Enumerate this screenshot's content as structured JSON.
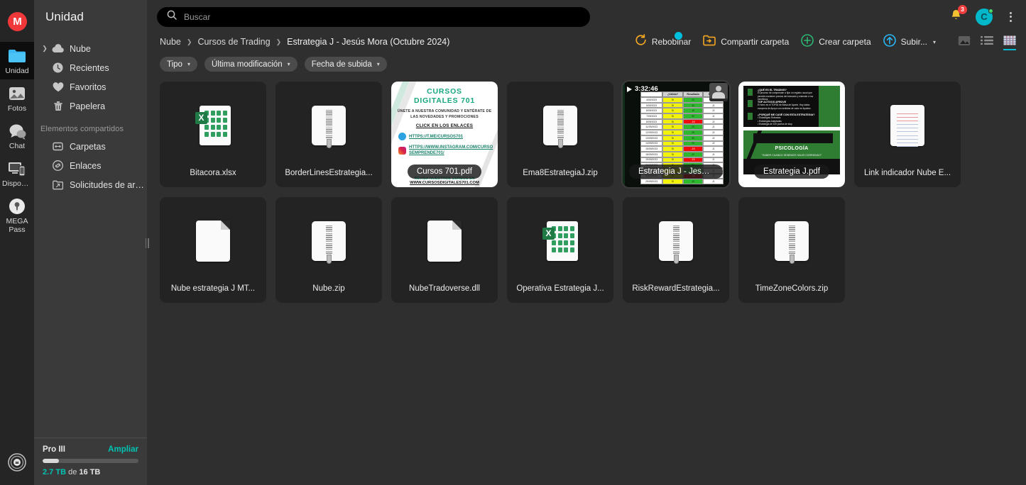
{
  "app": {
    "logo_letter": "M",
    "sidebar_title": "Unidad"
  },
  "rail": {
    "items": [
      {
        "name": "unidad",
        "label": "Unidad",
        "icon": "folder-icon",
        "active": true
      },
      {
        "name": "fotos",
        "label": "Fotos",
        "icon": "photo-icon",
        "active": false
      },
      {
        "name": "chat",
        "label": "Chat",
        "icon": "chat-bubble-icon",
        "active": false
      },
      {
        "name": "dispositivos",
        "label": "Disposi...",
        "icon": "devices-icon",
        "active": false
      },
      {
        "name": "mega-pass",
        "label": "MEGA Pass",
        "icon": "lock-key-icon",
        "active": false
      }
    ]
  },
  "sidebar": {
    "nav": [
      {
        "name": "nube",
        "label": "Nube",
        "icon": "cloud-icon",
        "expandable": true
      },
      {
        "name": "recientes",
        "label": "Recientes",
        "icon": "clock-icon"
      },
      {
        "name": "favoritos",
        "label": "Favoritos",
        "icon": "heart-icon"
      },
      {
        "name": "papelera",
        "label": "Papelera",
        "icon": "trash-icon"
      }
    ],
    "shared_section_label": "Elementos compartidos",
    "shared": [
      {
        "name": "carpetas",
        "label": "Carpetas",
        "icon": "shared-folder-icon"
      },
      {
        "name": "enlaces",
        "label": "Enlaces",
        "icon": "link-icon"
      },
      {
        "name": "solicitudes",
        "label": "Solicitudes de arc...",
        "icon": "file-request-icon"
      }
    ],
    "storage": {
      "plan": "Pro III",
      "upgrade_label": "Ampliar",
      "used": "2.7 TB",
      "of_word": "de",
      "total": "16 TB",
      "percent": 17,
      "accent_color": "#00c3b2"
    }
  },
  "search": {
    "placeholder": "Buscar",
    "value": "",
    "icon": "search-icon"
  },
  "header": {
    "notifications": {
      "icon": "bell-icon",
      "count": "3"
    },
    "avatar": {
      "letter": "C",
      "status": "online",
      "color": "#00b8c9"
    },
    "more": {
      "icon": "kebab-menu-icon"
    }
  },
  "breadcrumb": {
    "items": [
      "Nube",
      "Cursos de Trading",
      "Estrategia J - Jesús Mora (Octubre 2024)"
    ],
    "separator": "❯"
  },
  "toolbar": {
    "actions": [
      {
        "name": "rebobinar",
        "label": "Rebobinar",
        "icon": "rewind-icon",
        "badge": true
      },
      {
        "name": "compartir-carpeta",
        "label": "Compartir carpeta",
        "icon": "share-folder-icon"
      },
      {
        "name": "crear-carpeta",
        "label": "Crear carpeta",
        "icon": "plus-circle-icon"
      },
      {
        "name": "subir",
        "label": "Subir...",
        "icon": "upload-circle-icon",
        "chevron": true
      }
    ],
    "views": [
      {
        "name": "gallery-view",
        "icon": "gallery-icon",
        "active": false
      },
      {
        "name": "list-view",
        "icon": "list-icon",
        "active": false
      },
      {
        "name": "grid-view",
        "icon": "grid-icon",
        "active": true
      }
    ],
    "active_accent": "#00bcd4"
  },
  "filters": [
    {
      "name": "tipo",
      "label": "Tipo"
    },
    {
      "name": "ultima-modificacion",
      "label": "Última modificación"
    },
    {
      "name": "fecha-de-subida",
      "label": "Fecha de subida"
    }
  ],
  "files": [
    {
      "name": "Bitacora.xlsx",
      "kind": "xlsx",
      "thumb": false,
      "selected": false
    },
    {
      "name": "BorderLinesEstrategia...",
      "kind": "zip",
      "thumb": false,
      "selected": false
    },
    {
      "name": "Cursos 701.pdf",
      "kind": "pdf",
      "thumb": "cursos701",
      "selected": false
    },
    {
      "name": "Ema8EstrategiaJ.zip",
      "kind": "zip",
      "thumb": false,
      "selected": false
    },
    {
      "name": "Estrategia J - Jesus M...",
      "kind": "video",
      "thumb": "video",
      "selected": true,
      "duration": "3:32:46"
    },
    {
      "name": "Estrategia J.pdf",
      "kind": "pdf",
      "thumb": "estrategiaj",
      "selected": false
    },
    {
      "name": "Link indicador Nube E...",
      "kind": "txt",
      "thumb": false,
      "selected": false
    },
    {
      "name": "Nube estrategia J MT...",
      "kind": "file",
      "thumb": false,
      "selected": false
    },
    {
      "name": "Nube.zip",
      "kind": "zip",
      "thumb": false,
      "selected": false
    },
    {
      "name": "NubeTradoverse.dll",
      "kind": "file",
      "thumb": false,
      "selected": false
    },
    {
      "name": "Operativa Estrategia J...",
      "kind": "xlsx",
      "thumb": false,
      "selected": false
    },
    {
      "name": "RiskRewardEstrategia...",
      "kind": "zip",
      "thumb": false,
      "selected": false
    },
    {
      "name": "TimeZoneColors.zip",
      "kind": "zip",
      "thumb": false,
      "selected": false
    }
  ],
  "video_thumb": {
    "columns": [
      "",
      "¿Válido?",
      "Resultado",
      "Entrada"
    ],
    "rows": [
      {
        "date": "4/09/2023",
        "valid": "Sí",
        "result": "20",
        "entry": "J1",
        "state": "good"
      },
      {
        "date": "5/09/2023",
        "valid": "Sí",
        "result": "30",
        "entry": "J1",
        "state": "good"
      },
      {
        "date": "8/09/2023",
        "valid": "Sí",
        "result": "15",
        "entry": "J2",
        "state": "good"
      },
      {
        "date": "7/09/2023",
        "valid": "Sí",
        "result": "30",
        "entry": "J1",
        "state": "good"
      },
      {
        "date": "8/09/2023",
        "valid": "Sí",
        "result": "-15",
        "entry": "J2",
        "state": "bad"
      },
      {
        "date": "11/09/2023",
        "valid": "Sí",
        "result": "20",
        "entry": "J1",
        "state": "good"
      },
      {
        "date": "12/09/2023",
        "valid": "Sí",
        "result": "25",
        "entry": "J2",
        "state": "good"
      },
      {
        "date": "13/09/2023",
        "valid": "Sí",
        "result": "30",
        "entry": "J2",
        "state": "good"
      },
      {
        "date": "14/09/2023",
        "valid": "Sí",
        "result": "20",
        "entry": "J2",
        "state": "good"
      },
      {
        "date": "15/09/2023",
        "valid": "Sí",
        "result": "-15",
        "entry": "J1",
        "state": "bad"
      },
      {
        "date": "18/09/2023",
        "valid": "Sí",
        "result": "20",
        "entry": "J1",
        "state": "good"
      },
      {
        "date": "19/09/2023",
        "valid": "Sí",
        "result": "-15",
        "entry": "J1",
        "state": "bad"
      },
      {
        "date": "20/09/2023",
        "valid": "Sí",
        "result": "25",
        "entry": "J2",
        "state": "good"
      },
      {
        "date": "21/09/2023",
        "valid": "Sí",
        "result": "30",
        "entry": "J1",
        "state": "good"
      },
      {
        "date": "22/09/2023",
        "valid": "Sí",
        "result": "-15",
        "entry": "J2",
        "state": "bad"
      },
      {
        "date": "25/09/2023",
        "valid": "Sí",
        "result": "15",
        "entry": "J1",
        "state": "good"
      }
    ]
  },
  "cursos_thumb": {
    "title_line1": "CURSOS",
    "title_line2": "DIGITALES 701",
    "subtitle": "ÚNETE A NUESTRA COMUNIDAD Y ENTÉRATE DE LAS NOVEDADES Y PROMOCIONES",
    "cta": "CLICK EN LOS ENLACES",
    "telegram": "HTTPS://T.ME/CURSOS701",
    "instagram": "HTTPS://WWW.INSTAGRAM.COM/CURSOSEMPRENDE701/",
    "footer_pre": "REVISA NUESTROS CURSOS EN",
    "footer_site": "WWW.CURSOSDIGITALES701.COM"
  },
  "estrategia_thumb": {
    "page1_heading1": "¿QUÉ ES EL TRADING?",
    "page1_heading2": "TOP ACTIVOS APROVE",
    "page1_heading3": "¿PORQUÉ ME CASÉ CON ESTA ESTRATEGIA?",
    "page2_title": "PSICOLOGÍA",
    "page2_quote": "\"SABER CUANDO DEBEMOS SALIR CORRIENDO\""
  }
}
